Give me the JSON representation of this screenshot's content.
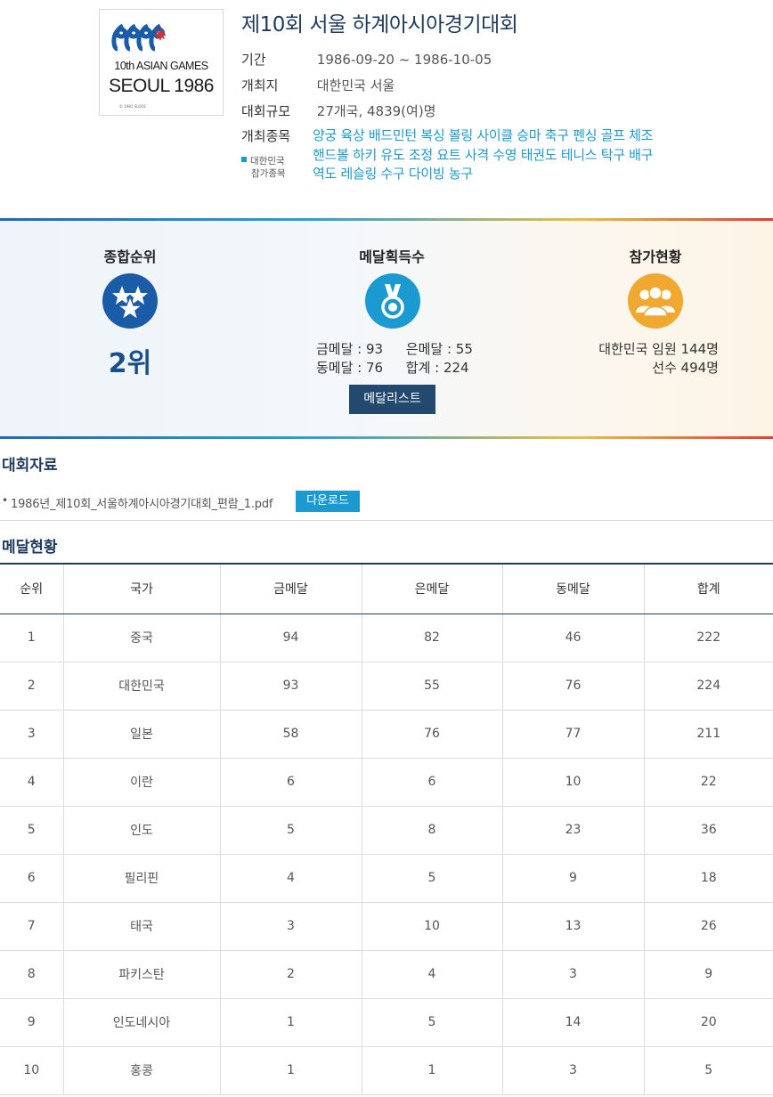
{
  "event": {
    "title": "제10회 서울 하계아시아경기대회",
    "logo": {
      "line1": "10th ASIAN GAMES",
      "line2": "SEOUL 1986"
    },
    "info": [
      {
        "label": "기간",
        "value": "1986-09-20 ~ 1986-10-05"
      },
      {
        "label": "개최지",
        "value": "대한민국 서울"
      },
      {
        "label": "대회규모",
        "value": "27개국, 4839(여)명"
      },
      {
        "label": "개최종목",
        "value": ""
      }
    ],
    "sports_lines": [
      "양궁 육상 배드민턴 복싱 볼링 사이클 승마 축구 펜싱 골프 체조",
      "핸드볼 하키 유도 조정 요트 사격 수영 태권도 테니스 탁구 배구",
      "역도 레슬링 수구 다이빙 농구"
    ],
    "korea_note": [
      "대한민국",
      "참가종목"
    ]
  },
  "summary": {
    "rank_title": "종합순위",
    "rank_value": "2위",
    "medal_title": "메달획득수",
    "medals": {
      "gold_label": "금메달 : 93",
      "silver_label": "은메달 : 55",
      "bronze_label": "동메달 : 76",
      "total_label": "합계 : 224"
    },
    "medal_list_button": "메달리스트",
    "participation_title": "참가현황",
    "participation_lines": [
      "대한민국 임원 144명",
      "선수 494명"
    ],
    "colors": {
      "rank": "#1a5ca8",
      "medal": "#1a9ad0",
      "participation": "#f0a830"
    }
  },
  "documents": {
    "heading": "대회자료",
    "files": [
      {
        "name": "1986년_제10회_서울하계아시아경기대회_편람_1.pdf",
        "button": "다운로드"
      }
    ]
  },
  "medal_table": {
    "heading": "메달현황",
    "columns": [
      "순위",
      "국가",
      "금메달",
      "은메달",
      "동메달",
      "합계"
    ],
    "rows": [
      [
        "1",
        "중국",
        "94",
        "82",
        "46",
        "222"
      ],
      [
        "2",
        "대한민국",
        "93",
        "55",
        "76",
        "224"
      ],
      [
        "3",
        "일본",
        "58",
        "76",
        "77",
        "211"
      ],
      [
        "4",
        "이란",
        "6",
        "6",
        "10",
        "22"
      ],
      [
        "5",
        "인도",
        "5",
        "8",
        "23",
        "36"
      ],
      [
        "6",
        "필리핀",
        "4",
        "5",
        "9",
        "18"
      ],
      [
        "7",
        "태국",
        "3",
        "10",
        "13",
        "26"
      ],
      [
        "8",
        "파키스탄",
        "2",
        "4",
        "3",
        "9"
      ],
      [
        "9",
        "인도네시아",
        "1",
        "5",
        "14",
        "20"
      ],
      [
        "10",
        "홍콩",
        "1",
        "1",
        "3",
        "5"
      ]
    ]
  }
}
